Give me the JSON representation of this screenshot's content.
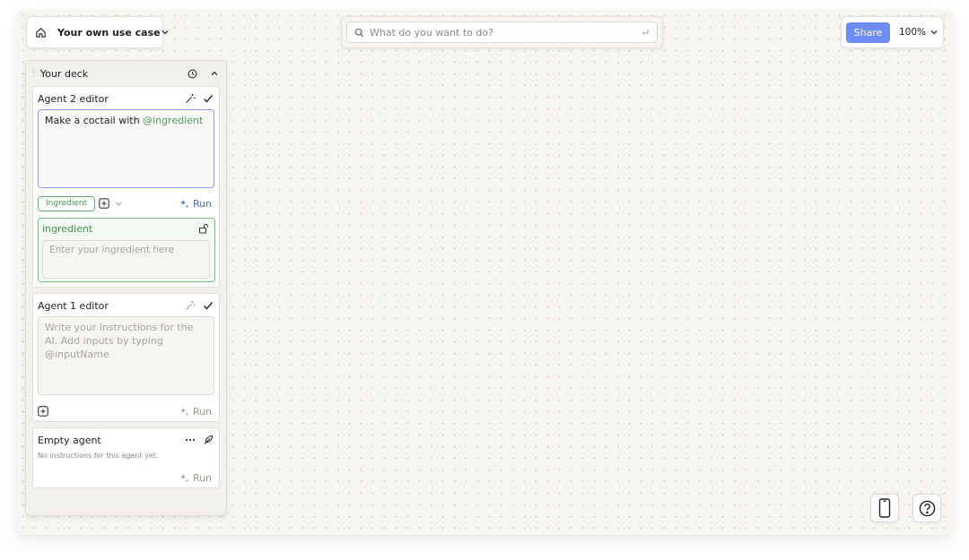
{
  "topbar": {
    "usecase_label": "Your own use case",
    "search_placeholder": "What do you want to do?",
    "share_label": "Share",
    "zoom_label": "100%"
  },
  "deck": {
    "title": "Your deck",
    "agents": [
      {
        "title": "Agent 2 editor",
        "prompt_prefix": "Make a coctail with ",
        "prompt_mention": "@ingredient",
        "input_chip": "Ingredient",
        "run_label": "Run",
        "input": {
          "name": "ingredient",
          "placeholder": "Enter your ingredient here"
        }
      },
      {
        "title": "Agent 1 editor",
        "prompt_placeholder": "Write your instructions for the AI. Add inputs by typing @inputName",
        "run_label": "Run"
      },
      {
        "title": "Empty agent",
        "note": "No instructions for this agent yet.",
        "run_label": "Run"
      }
    ]
  },
  "colors": {
    "accent": "#6d8cf5",
    "mention": "#4aa05a",
    "canvas": "#f7f5f1"
  },
  "icons": [
    "home-icon",
    "chevron-down-icon",
    "search-icon",
    "enter-icon",
    "history-icon",
    "chevron-up-icon",
    "magic-wand-icon",
    "check-icon",
    "plus-square-icon",
    "sparkle-icon",
    "unlock-icon",
    "more-icon",
    "feather-icon",
    "phone-icon",
    "help-icon"
  ]
}
